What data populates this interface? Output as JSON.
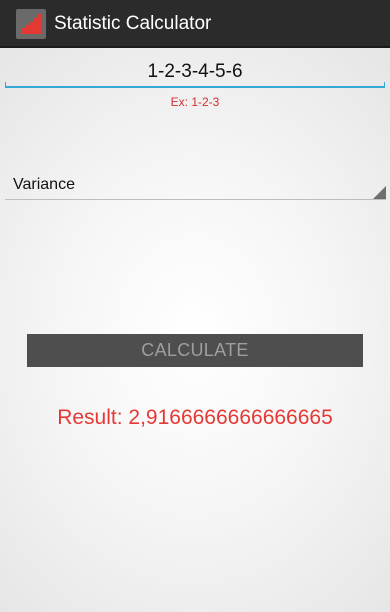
{
  "app": {
    "title": "Statistic Calculator",
    "icon": "bar-chart-icon",
    "accent_color": "#d32f2f"
  },
  "input": {
    "value": "1-2-3-4-5-6",
    "hint": "Ex: 1-2-3"
  },
  "spinner": {
    "selected": "Variance"
  },
  "calculate": {
    "label": "CALCULATE"
  },
  "result": {
    "text": "Result: 2,9166666666666665"
  }
}
